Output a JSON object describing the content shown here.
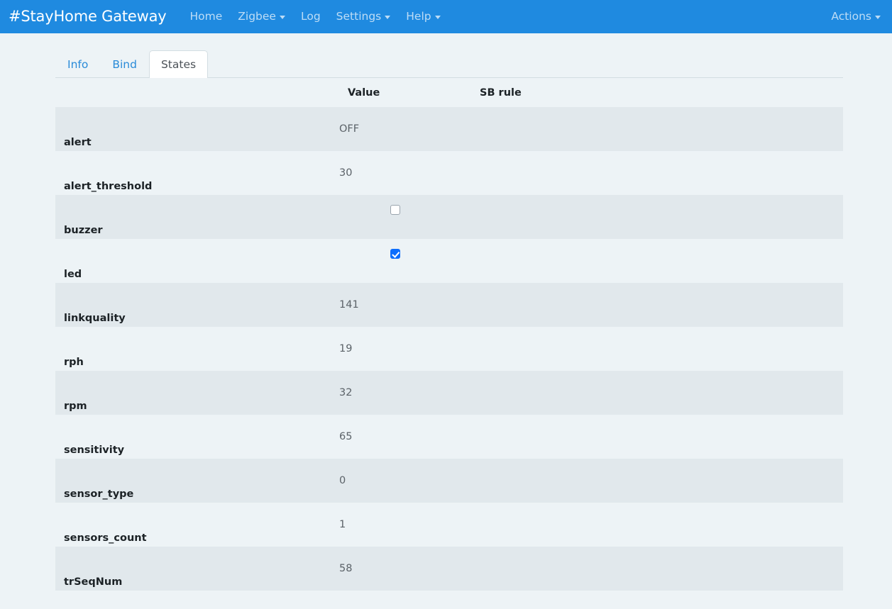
{
  "navbar": {
    "brand": "#StayHome Gateway",
    "links": [
      {
        "label": "Home",
        "dropdown": false
      },
      {
        "label": "Zigbee",
        "dropdown": true
      },
      {
        "label": "Log",
        "dropdown": false
      },
      {
        "label": "Settings",
        "dropdown": true
      },
      {
        "label": "Help",
        "dropdown": true
      }
    ],
    "right": {
      "label": "Actions",
      "dropdown": true
    },
    "background_color": "#1f8ae0",
    "brand_color": "#ffffff",
    "link_color": "rgba(255,255,255,0.70)"
  },
  "tabs": [
    {
      "label": "Info",
      "active": false
    },
    {
      "label": "Bind",
      "active": false
    },
    {
      "label": "States",
      "active": true
    }
  ],
  "table": {
    "headers": {
      "name": "",
      "value": "Value",
      "rule": "SB rule"
    },
    "rows": [
      {
        "name": "alert",
        "type": "text",
        "value": "OFF",
        "rule": ""
      },
      {
        "name": "alert_threshold",
        "type": "text",
        "value": "30",
        "rule": ""
      },
      {
        "name": "buzzer",
        "type": "checkbox",
        "checked": false,
        "value": "",
        "rule": ""
      },
      {
        "name": "led",
        "type": "checkbox",
        "checked": true,
        "value": "",
        "rule": ""
      },
      {
        "name": "linkquality",
        "type": "text",
        "value": "141",
        "rule": ""
      },
      {
        "name": "rph",
        "type": "text",
        "value": "19",
        "rule": ""
      },
      {
        "name": "rpm",
        "type": "text",
        "value": "32",
        "rule": ""
      },
      {
        "name": "sensitivity",
        "type": "text",
        "value": "65",
        "rule": ""
      },
      {
        "name": "sensor_type",
        "type": "text",
        "value": "0",
        "rule": ""
      },
      {
        "name": "sensors_count",
        "type": "text",
        "value": "1",
        "rule": ""
      },
      {
        "name": "trSeqNum",
        "type": "text",
        "value": "58",
        "rule": ""
      }
    ]
  },
  "colors": {
    "page_background": "#edf3f6",
    "stripe_row": "#e1e8ec",
    "accent_blue": "#1f8ae0",
    "link_blue": "#2a8bd8",
    "checkbox_checked": "#0d6efd",
    "text_dark": "#1c2226",
    "text_muted": "#5b6268"
  }
}
